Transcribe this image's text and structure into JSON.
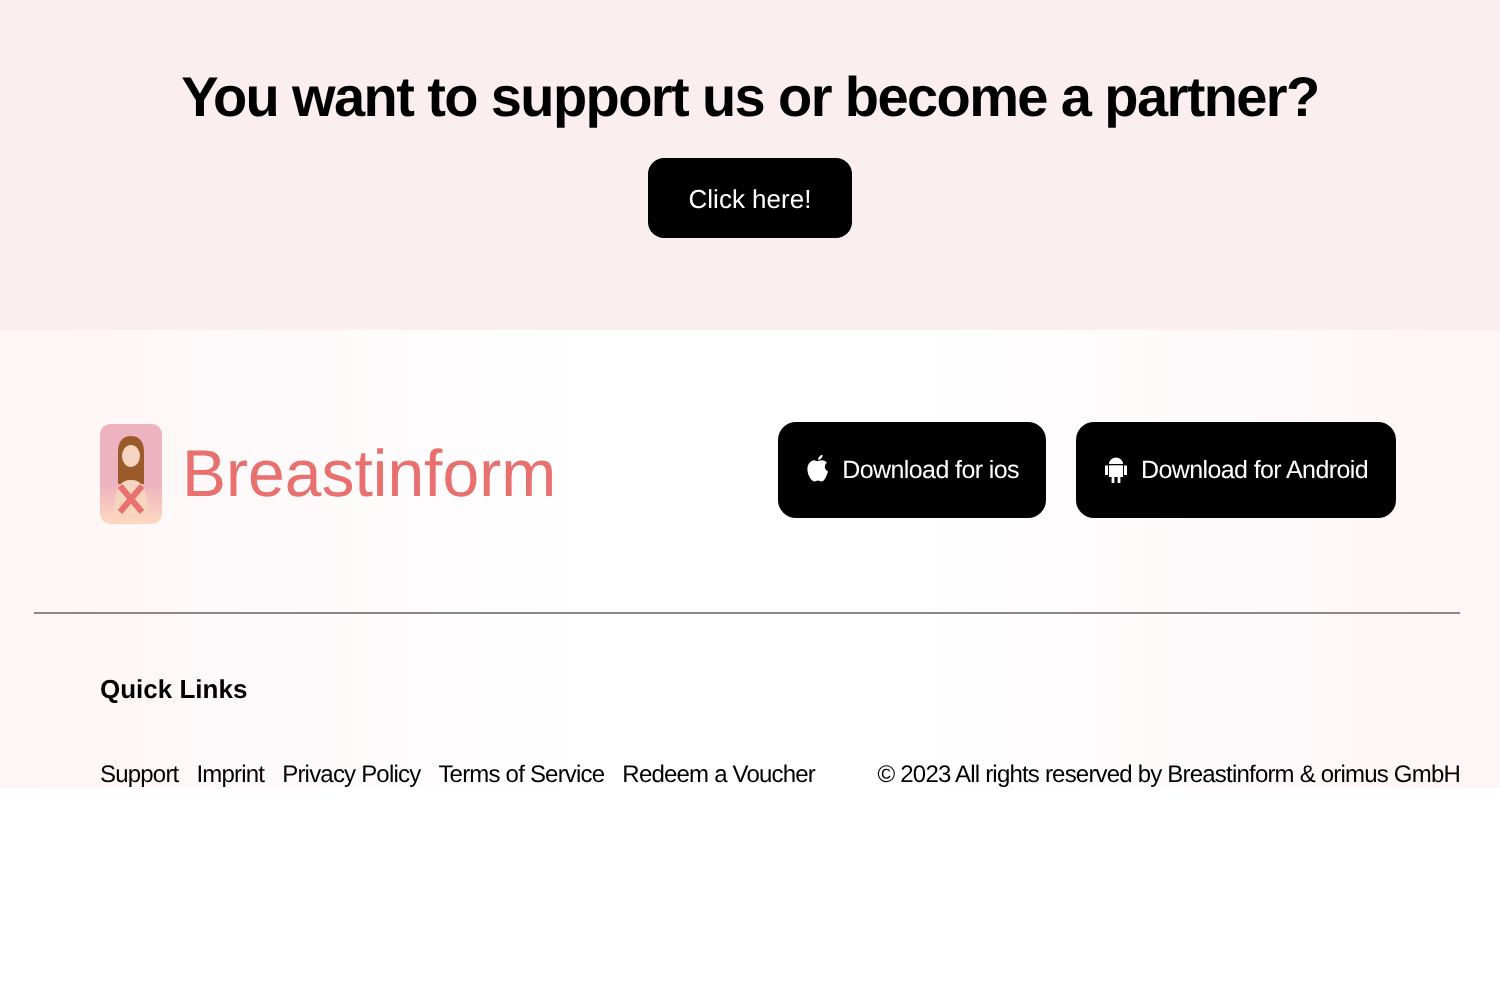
{
  "cta": {
    "heading": "You want to support us or become a partner?",
    "button": "Click here!"
  },
  "footer": {
    "brand": "Breastinform",
    "downloads": [
      {
        "kind": "ios",
        "label": "Download for ios"
      },
      {
        "kind": "android",
        "label": "Download for Android"
      }
    ],
    "quick_links_title": "Quick Links",
    "links": [
      "Support",
      "Imprint",
      "Privacy Policy",
      "Terms of Service",
      "Redeem a Voucher"
    ],
    "copyright": "© 2023 All rights reserved by Breastinform & orimus GmbH"
  }
}
